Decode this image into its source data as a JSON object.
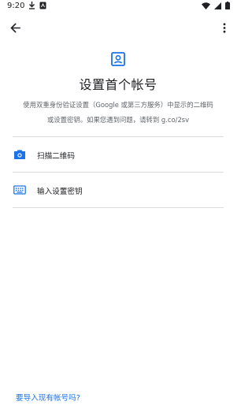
{
  "status_bar": {
    "time": "9:20",
    "left_icons": [
      "download-icon",
      "notification-icon"
    ],
    "right_icons": [
      "wifi-icon",
      "signal-icon",
      "battery-icon"
    ]
  },
  "toolbar": {
    "back_icon": "arrow-back-icon",
    "menu_icon": "more-vert-icon"
  },
  "header": {
    "icon": "account-box-icon",
    "title": "设置首个帐号",
    "description_line1": "使用双重身份验证设置（Google 或第三方服务）中显示的二维码",
    "description_line2": "或设置密钥。如果您遇到问题，请转到 g.co/2sv"
  },
  "options": [
    {
      "icon": "camera-icon",
      "label": "扫描二维码"
    },
    {
      "icon": "keyboard-icon",
      "label": "输入设置密钥"
    }
  ],
  "footer": {
    "import_link": "要导入现有帐号吗?"
  },
  "colors": {
    "accent": "#1a73e8",
    "text_primary": "#202124",
    "text_secondary": "#5f6368",
    "divider": "#dadce0"
  }
}
